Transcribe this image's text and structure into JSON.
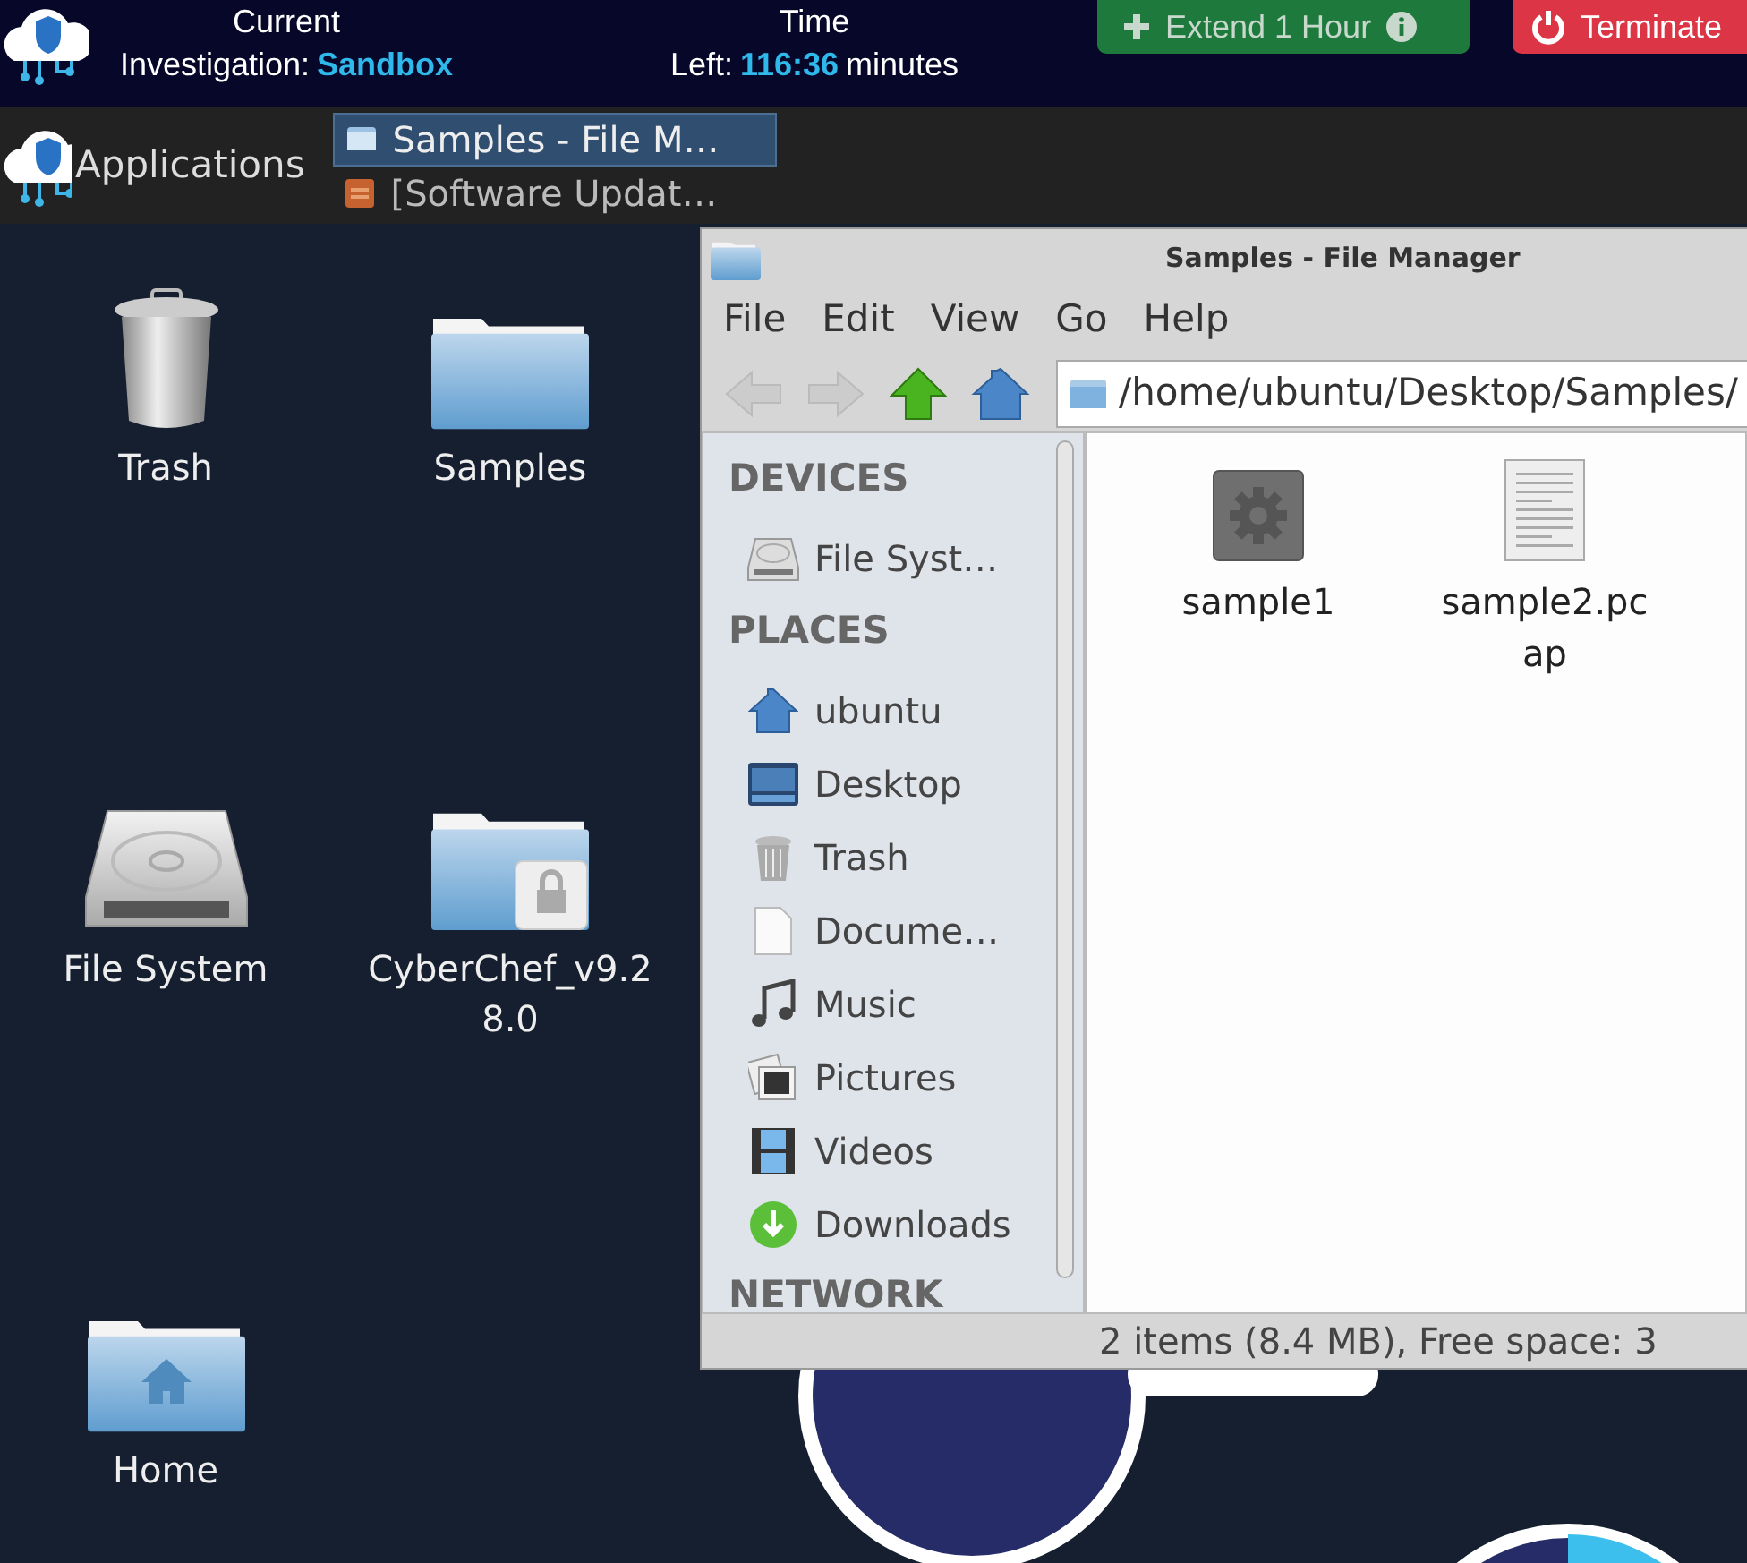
{
  "top_bar": {
    "investigation": {
      "heading": "Current",
      "label": "Investigation:",
      "value": "Sandbox"
    },
    "time": {
      "heading": "Time",
      "label": "Left:",
      "value": "116:36",
      "unit": "minutes"
    },
    "buttons": [
      {
        "kind": "extend",
        "label": "Extend 1 Hour"
      },
      {
        "kind": "terminate",
        "label": "Terminate"
      }
    ]
  },
  "taskbar": {
    "menu_label": "Applications",
    "tasks": [
      {
        "label": "Samples - File M…",
        "kind": "folder",
        "selected": true
      },
      {
        "label": "[Software Updat…",
        "kind": "updater",
        "selected": false
      }
    ]
  },
  "desktop_icons": [
    {
      "label": "Trash",
      "kind": "trash"
    },
    {
      "label": "Samples",
      "kind": "folder"
    },
    {
      "label": "File System",
      "kind": "drive"
    },
    {
      "label": "CyberChef_v9.28.0",
      "kind": "locked-folder"
    },
    {
      "label": "Home",
      "kind": "home-folder"
    }
  ],
  "file_manager": {
    "title": "Samples - File Manager",
    "menu": [
      "File",
      "Edit",
      "View",
      "Go",
      "Help"
    ],
    "toolbar": [
      {
        "kind": "back",
        "disabled": true
      },
      {
        "kind": "forward",
        "disabled": true
      },
      {
        "kind": "up",
        "disabled": false
      },
      {
        "kind": "home",
        "disabled": false
      }
    ],
    "path": "/home/ubuntu/Desktop/Samples/",
    "sidebar": [
      {
        "heading": "DEVICES",
        "items": [
          {
            "label": "File Syst…",
            "kind": "drive"
          }
        ]
      },
      {
        "heading": "PLACES",
        "items": [
          {
            "label": "ubuntu",
            "kind": "home"
          },
          {
            "label": "Desktop",
            "kind": "desktop"
          },
          {
            "label": "Trash",
            "kind": "trash"
          },
          {
            "label": "Docume…",
            "kind": "document"
          },
          {
            "label": "Music",
            "kind": "music"
          },
          {
            "label": "Pictures",
            "kind": "pictures"
          },
          {
            "label": "Videos",
            "kind": "videos"
          },
          {
            "label": "Downloads",
            "kind": "downloads"
          }
        ]
      },
      {
        "heading": "NETWORK"
      }
    ],
    "files": [
      {
        "name": "sample1",
        "kind": "executable"
      },
      {
        "name": "sample2.pcap",
        "kind": "document"
      }
    ],
    "status": "2 items (8.4 MB), Free space: 3"
  }
}
